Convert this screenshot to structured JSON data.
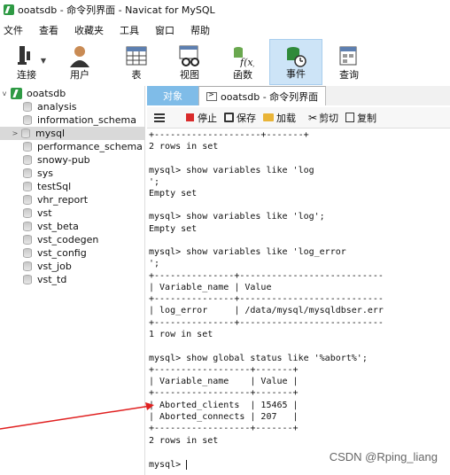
{
  "window": {
    "title": "ooatsdb - 命令列界面 - Navicat for MySQL"
  },
  "menu": {
    "items": [
      "文件",
      "查看",
      "收藏夹",
      "工具",
      "窗口",
      "帮助"
    ]
  },
  "toolbar": {
    "buttons": [
      {
        "label": "连接",
        "icon": "connection-icon"
      },
      {
        "label": "用户",
        "icon": "user-icon"
      },
      {
        "label": "表",
        "icon": "table-icon"
      },
      {
        "label": "视图",
        "icon": "view-icon"
      },
      {
        "label": "函数",
        "icon": "function-icon",
        "icon_text": "f(x)"
      },
      {
        "label": "事件",
        "icon": "event-icon"
      },
      {
        "label": "查询",
        "icon": "query-icon"
      }
    ],
    "active": "事件"
  },
  "sidebar": {
    "root": "ooatsdb",
    "items": [
      "analysis",
      "information_schema",
      "mysql",
      "performance_schema",
      "snowy-pub",
      "sys",
      "testSql",
      "vhr_report",
      "vst",
      "vst_beta",
      "vst_codegen",
      "vst_config",
      "vst_job",
      "vst_td"
    ],
    "selected": "mysql"
  },
  "tabs": {
    "objects": "对象",
    "command": "ooatsdb - 命令列界面"
  },
  "cmdbar": {
    "stop": "停止",
    "save": "保存",
    "load": "加载",
    "cut": "剪切",
    "copy": "复制"
  },
  "console": {
    "lines": [
      "+--------------------+-------+",
      "2 rows in set",
      "",
      "mysql> show variables like 'log",
      "';",
      "Empty set",
      "",
      "mysql> show variables like 'log';",
      "Empty set",
      "",
      "mysql> show variables like 'log_error",
      "';",
      "+---------------+---------------------------",
      "| Variable_name | Value",
      "+---------------+---------------------------",
      "| log_error     | /data/mysql/mysqldbser.err",
      "+---------------+---------------------------",
      "1 row in set",
      "",
      "mysql> show global status like '%abort%';",
      "+------------------+-------+",
      "| Variable_name    | Value |",
      "+------------------+-------+",
      "| Aborted_clients  | 15465 |",
      "| Aborted_connects | 207   |",
      "+------------------+-------+",
      "2 rows in set",
      "",
      "mysql> "
    ]
  },
  "credit": "CSDN @Rping_liang",
  "colors": {
    "accent": "#2e9a44",
    "tab_active": "#7fbce8",
    "stop": "#d92b2b",
    "arrow": "#e02020"
  }
}
